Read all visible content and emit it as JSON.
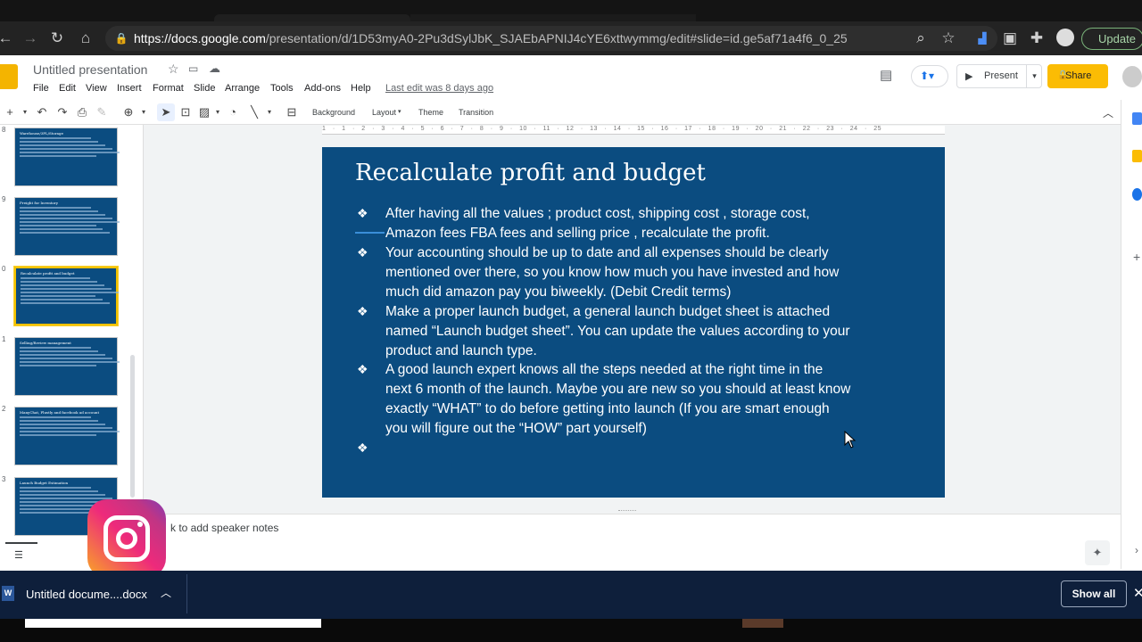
{
  "browser": {
    "url_domain": "https://docs.google.com",
    "url_path": "/presentation/d/1D53myA0-2Pu3dSylJbK_SJAEbAPNIJ4cYE6xttwymmg/edit#slide=id.ge5af71a4f6_0_25",
    "update_label": "Update"
  },
  "app": {
    "title": "Untitled presentation",
    "menus": [
      "File",
      "Edit",
      "View",
      "Insert",
      "Format",
      "Slide",
      "Arrange",
      "Tools",
      "Add-ons",
      "Help"
    ],
    "last_edit": "Last edit was 8 days ago",
    "present_label": "Present",
    "share_label": "Share"
  },
  "toolbar": {
    "background": "Background",
    "layout": "Layout",
    "theme": "Theme",
    "transition": "Transition"
  },
  "ruler_ticks": "1 · 1 · 2 · 3 · 4 · 5 · 6 · 7 · 8 · 9 · 10 · 11 · 12 · 13 · 14 · 15 · 16 · 17 · 18 · 19 · 20 · 21 · 22 · 23 · 24 · 25",
  "filmstrip": [
    {
      "num": "8",
      "title": "Warehouse/3PL/Storage",
      "lines": 6,
      "selected": false
    },
    {
      "num": "9",
      "title": "Freight for Inventory",
      "lines": 8,
      "selected": false
    },
    {
      "num": "0",
      "title": "Recalculate profit and budget",
      "lines": 8,
      "selected": true
    },
    {
      "num": "1",
      "title": "Selling/Review management",
      "lines": 6,
      "selected": false
    },
    {
      "num": "2",
      "title": "ManyChat, Plustly and facebook ad account",
      "lines": 6,
      "selected": false
    },
    {
      "num": "3",
      "title": "Launch Budget Estimation",
      "lines": 8,
      "selected": false
    }
  ],
  "slide": {
    "title": "Recalculate profit and budget",
    "bullets": [
      "After having all the values ; product cost, shipping cost , storage cost,\nAmazon fees FBA fees and selling price , recalculate the profit.",
      "Your accounting should be up to date and all expenses should be clearly\nmentioned over there, so you know how much you have invested and how\nmuch did amazon pay you biweekly. (Debit Credit terms)",
      "Make a proper launch budget, a general launch budget sheet is attached\nnamed “Launch budget sheet”. You can update the values according to your\nproduct and launch type.",
      "A good launch expert knows all the steps needed at the right time in the\nnext 6 month of the launch. Maybe you are new so you should at least know\nexactly “WHAT” to do before getting into launch (If you are smart enough\nyou will figure out the “HOW” part yourself)",
      ""
    ],
    "bullet_glyph": "❖"
  },
  "notes": {
    "placeholder": "k to add speaker notes"
  },
  "download": {
    "file": "Untitled docume....docx",
    "show_all": "Show all"
  },
  "colors": {
    "slide_bg": "#0b4c80",
    "share": "#fbbc04",
    "download_bar": "#0e1f3b"
  }
}
